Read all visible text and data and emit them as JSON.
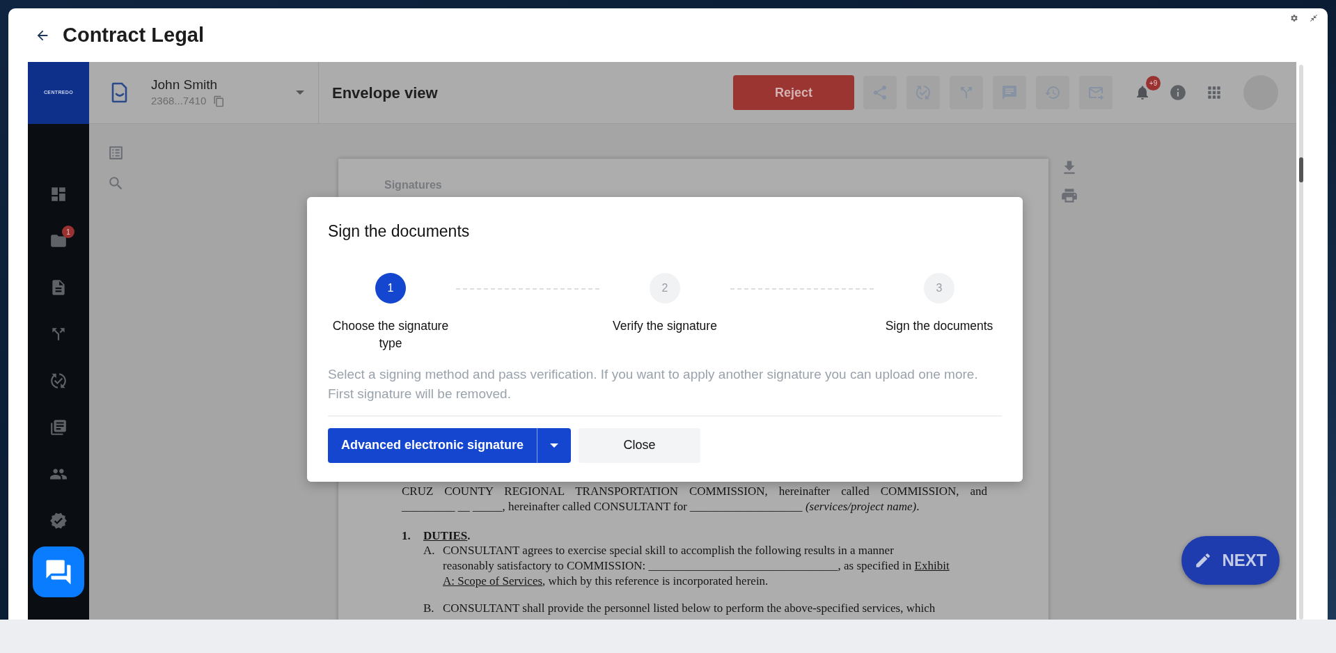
{
  "window": {
    "title": "Contract Legal"
  },
  "app": {
    "logo": "CENTREDO",
    "folder_badge": "1"
  },
  "envelope": {
    "owner": "John Smith",
    "id": "2368...7410"
  },
  "toolbar": {
    "title": "Envelope view",
    "reject": "Reject",
    "notifications_badge": "+9"
  },
  "document": {
    "section_label": "Signatures",
    "blocks": [
      {
        "kind": "paragraph",
        "lines": [
          [
            {
              "text": "CRUZ COUNTY REGIONAL TRANSPORTATION COMMISSION, hereinafter called COMMISSION, and",
              "underlined": false
            }
          ],
          [
            {
              "text": "_________ __ _____, hereinafter called CONSULTANT for ___________________ *(services/project name)*.",
              "underlined": false
            }
          ]
        ]
      },
      {
        "kind": "heading",
        "marker": "1.",
        "lines": [
          [
            {
              "text": "DUTIES",
              "underlined": true
            },
            {
              "text": ".",
              "underlined": false
            }
          ]
        ]
      },
      {
        "kind": "item",
        "marker": "A.",
        "lines": [
          [
            {
              "text": "CONSULTANT agrees to exercise special skill to accomplish the following results in a manner",
              "underlined": false
            }
          ],
          [
            {
              "text": "reasonably satisfactory to COMMISSION: ________________________________, as specified in ",
              "underlined": false
            },
            {
              "text": "Exhibit",
              "underlined": true
            }
          ],
          [
            {
              "text": "A: Scope of Services",
              "underlined": true
            },
            {
              "text": ", which by this reference is incorporated herein.",
              "underlined": false
            }
          ]
        ]
      },
      {
        "kind": "item",
        "marker": "B.",
        "lines": [
          [
            {
              "text": "CONSULTANT shall provide the personnel listed below to perform the above-specified services, which",
              "underlined": false
            }
          ]
        ]
      }
    ]
  },
  "dialog": {
    "title": "Sign the documents",
    "steps": [
      {
        "number": "1",
        "label": "Choose the signature type",
        "selected": true
      },
      {
        "number": "2",
        "label": "Verify the signature",
        "selected": false
      },
      {
        "number": "3",
        "label": "Sign the documents",
        "selected": false
      }
    ],
    "description": "Select a signing method and pass verification. If you want to apply another signature you can upload one more. First signature will be removed.",
    "primary_button": "Advanced electronic signature",
    "close_button": "Close"
  },
  "next_button": "NEXT"
}
